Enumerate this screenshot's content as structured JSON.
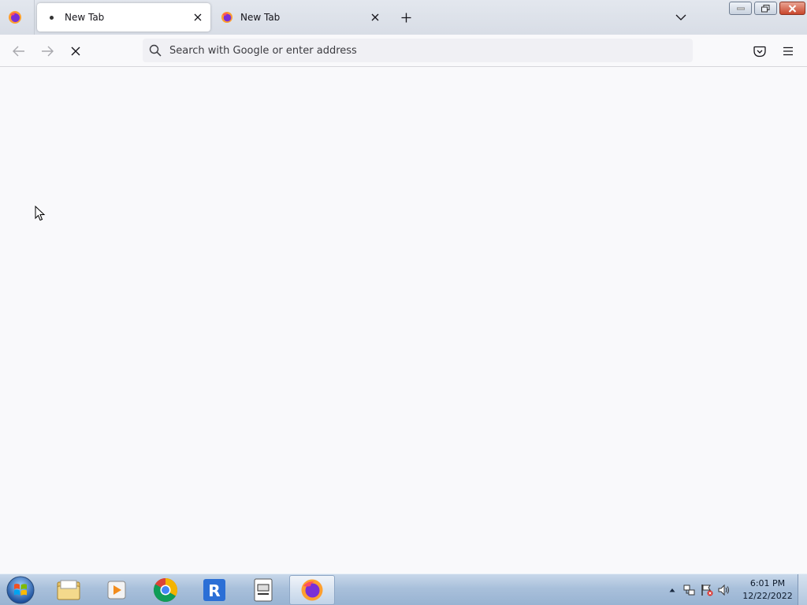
{
  "browser": {
    "tabs": [
      {
        "title": "New Tab",
        "state": "loading",
        "active": true
      },
      {
        "title": "New Tab",
        "state": "loaded",
        "active": false
      }
    ],
    "urlbar": {
      "placeholder": "Search with Google or enter address",
      "value": ""
    },
    "icons": {
      "app_menu": "firefox-logo-icon",
      "new_tab": "plus-icon",
      "tab_list": "chevron-down-icon",
      "back": "arrow-left-icon",
      "forward": "arrow-right-icon",
      "stop": "close-icon",
      "search": "search-icon",
      "pocket": "pocket-icon",
      "menu": "hamburger-icon"
    }
  },
  "taskbar": {
    "apps": [
      {
        "name": "file-explorer",
        "icon": "folder-icon"
      },
      {
        "name": "media-player",
        "icon": "media-player-icon"
      },
      {
        "name": "chrome",
        "icon": "chrome-icon"
      },
      {
        "name": "roblox",
        "icon": "roblox-icon"
      },
      {
        "name": "app-window",
        "icon": "window-app-icon"
      },
      {
        "name": "firefox",
        "icon": "firefox-icon",
        "active": true
      }
    ],
    "clock": {
      "time": "6:01 PM",
      "date": "12/22/2022"
    }
  },
  "colors": {
    "content_bg": "#f9f9fb",
    "tabstrip_bg": "#dde2ea",
    "taskbar_bg": "#a9c0db"
  }
}
